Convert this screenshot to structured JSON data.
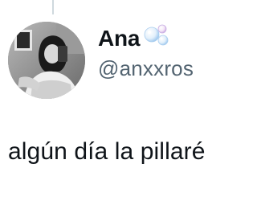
{
  "tweet": {
    "display_name": "Ana",
    "name_emoji": "bubbles-icon",
    "handle": "@anxxros",
    "text": "algún día la pillaré"
  },
  "avatar": {
    "icon": "avatar-photo",
    "style": "grayscale"
  },
  "colors": {
    "name": "#0f1419",
    "handle": "#536471",
    "text": "#0f1419",
    "thread_line": "#cfd9de"
  }
}
